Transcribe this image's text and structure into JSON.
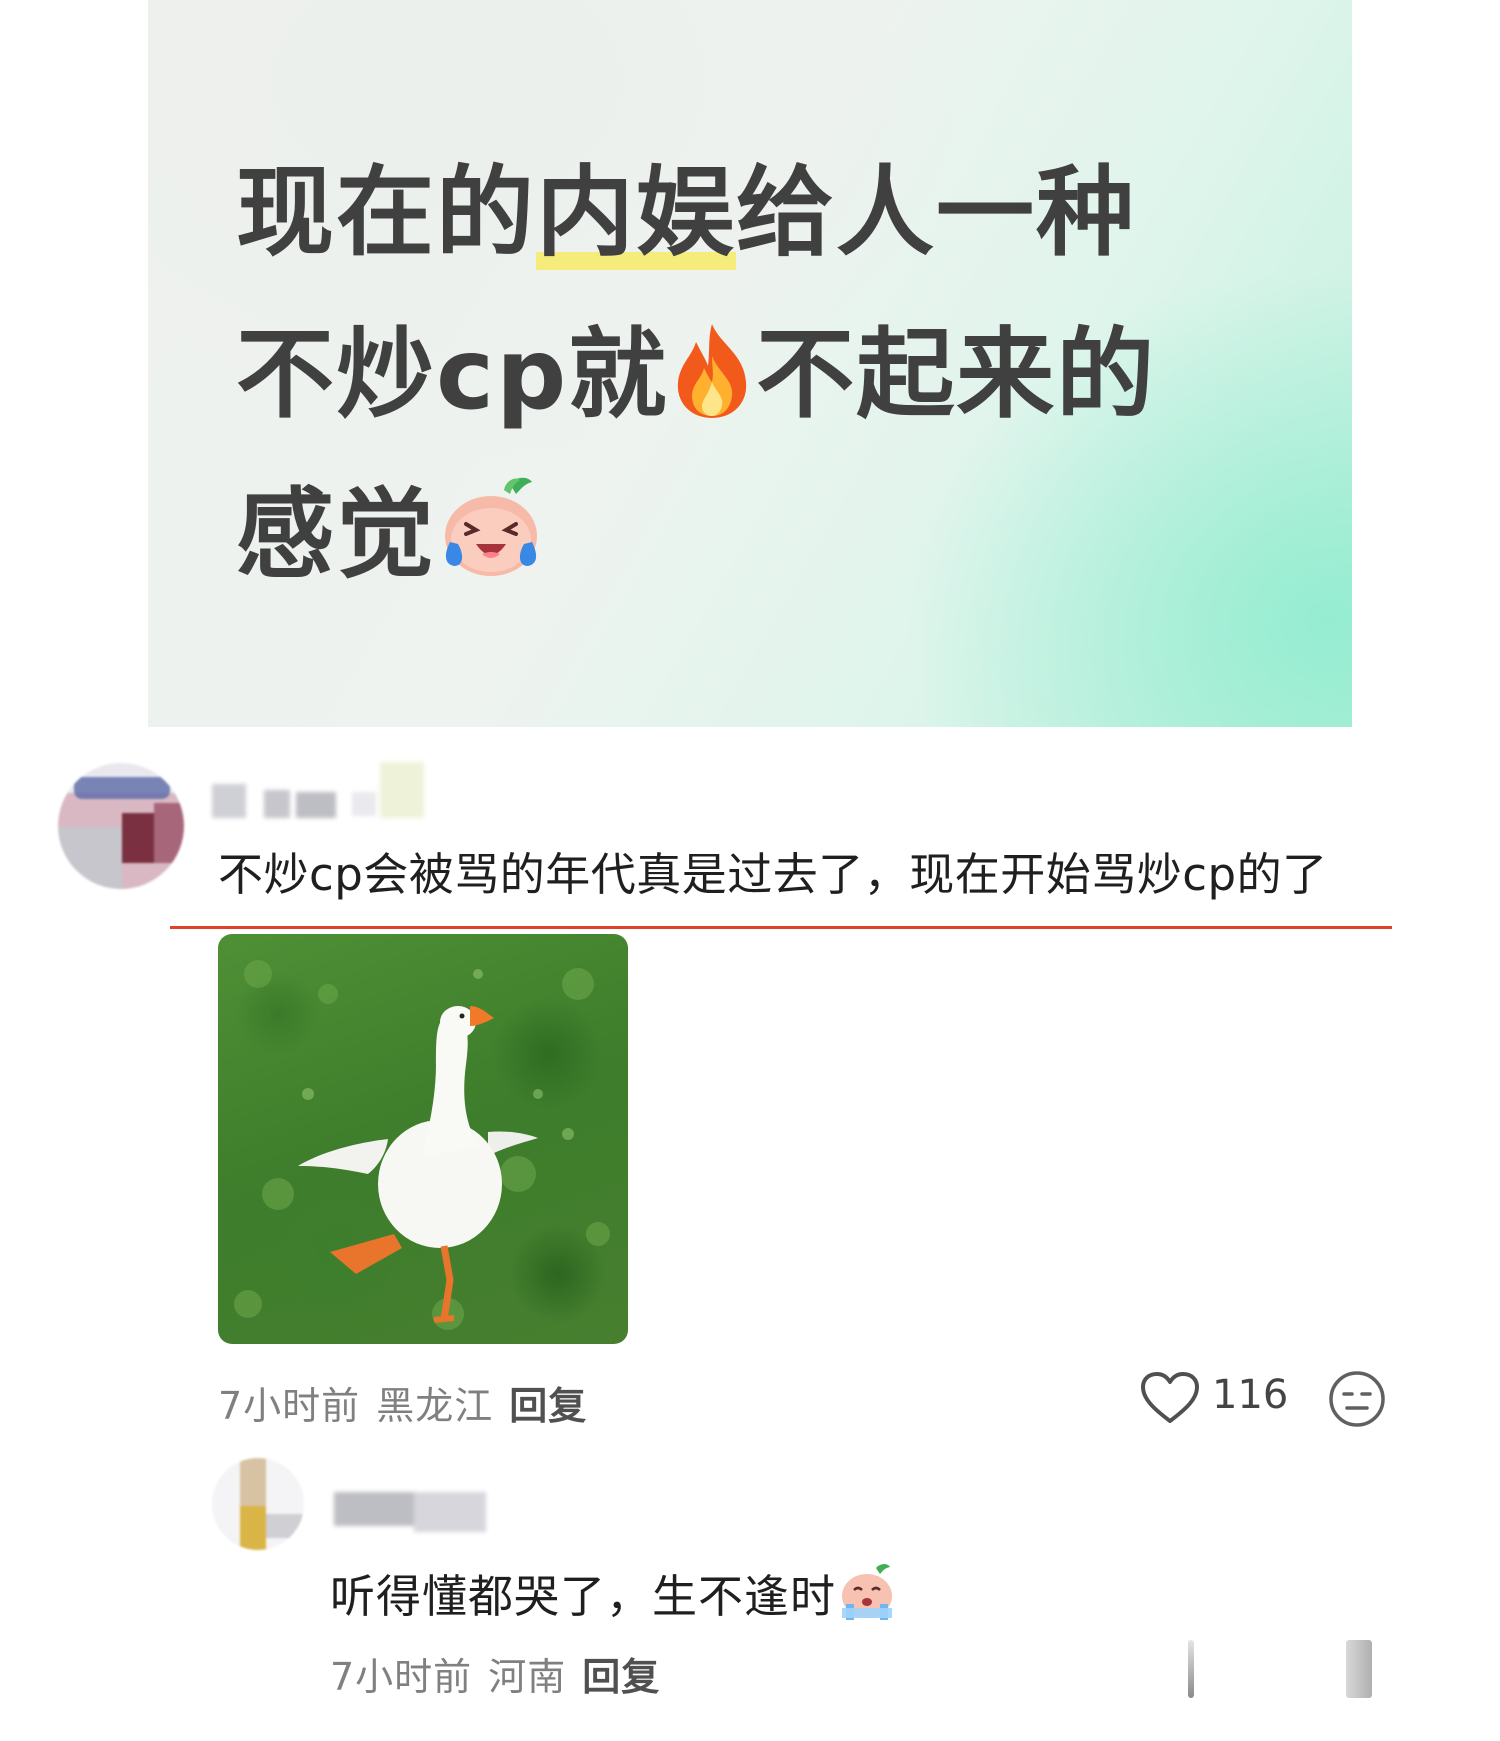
{
  "post": {
    "line1_a": "现在的",
    "line1_hl": "内娱",
    "line1_b": "给人一种",
    "line2_a": "不炒cp就",
    "line2_emoji": "fire-icon",
    "line2_b": "不起来的",
    "line3": "感觉",
    "line3_emoji": "crying-laughing-face-icon"
  },
  "comment": {
    "text": "不炒cp会被骂的年代真是过去了，现在开始骂炒cp的了",
    "image": "goose-photo",
    "time": "7小时前",
    "location": "黑龙江",
    "reply_label": "回复",
    "likes": "116",
    "like_icon": "heart-outline-icon",
    "react_icon": "neutral-face-icon"
  },
  "reply": {
    "text": "听得懂都哭了，生不逢时",
    "emoji": "crying-face-icon",
    "time": "7小时前",
    "location": "河南",
    "reply_label": "回复"
  },
  "colors": {
    "divider": "#e0412c",
    "highlight": "#f6ec7c"
  }
}
